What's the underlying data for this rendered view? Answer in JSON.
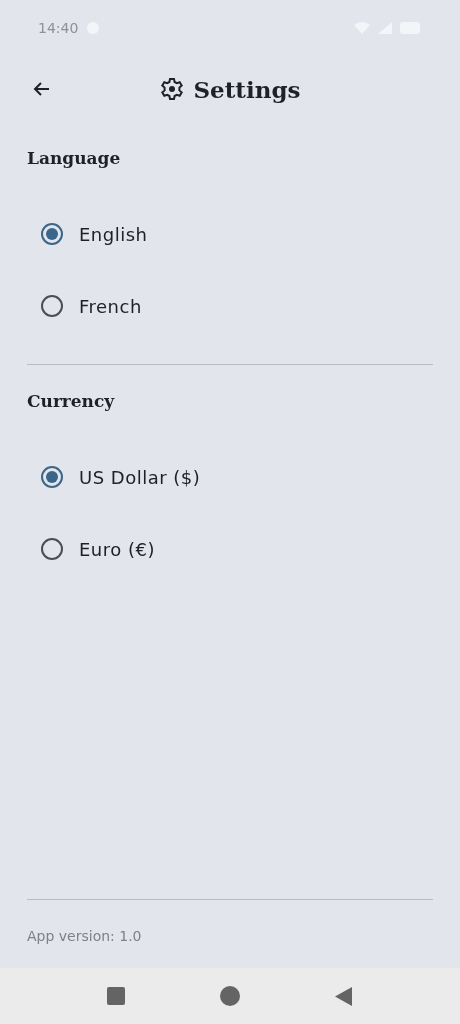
{
  "status_bar": {
    "time": "14:40"
  },
  "header": {
    "title": "Settings"
  },
  "sections": [
    {
      "title": "Language",
      "options": [
        {
          "label": "English",
          "selected": true
        },
        {
          "label": "French",
          "selected": false
        }
      ]
    },
    {
      "title": "Currency",
      "options": [
        {
          "label": "US Dollar ($)",
          "selected": true
        },
        {
          "label": "Euro (€)",
          "selected": false
        }
      ]
    }
  ],
  "footer": {
    "version": "App version: 1.0"
  }
}
